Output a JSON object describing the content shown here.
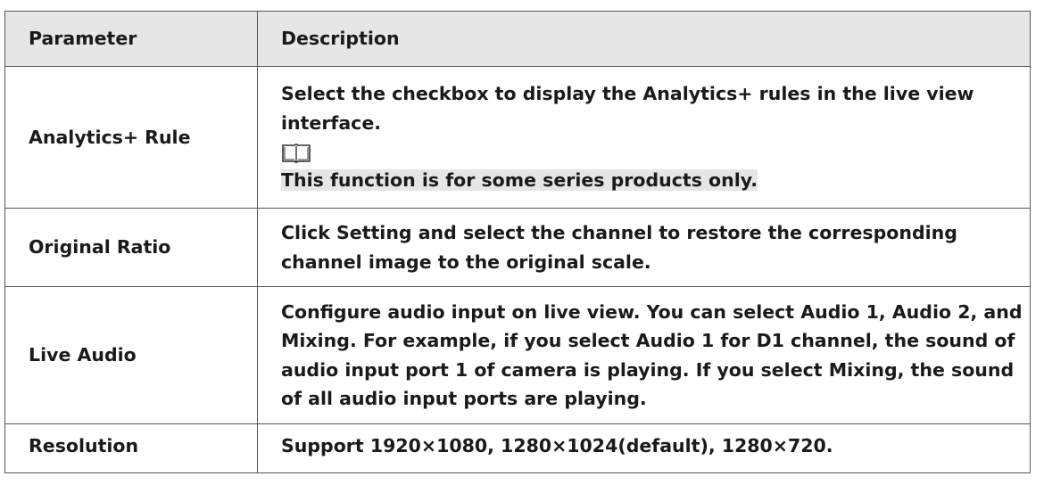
{
  "table": {
    "headers": {
      "parameter": "Parameter",
      "description": "Description"
    },
    "rows": [
      {
        "parameter": "Analytics+ Rule",
        "description": "Select the checkbox to display the Analytics+ rules in the live view interface.",
        "note_icon": "book-note-icon",
        "note": "This function is for some series products only."
      },
      {
        "parameter": "Original Ratio",
        "description": "Click Setting and select the channel to restore the corresponding channel image to the original scale."
      },
      {
        "parameter": "Live Audio",
        "description": "Configure audio input on live view. You can select Audio 1, Audio 2, and Mixing. For example, if you select Audio 1 for D1 channel, the sound of audio input port 1 of camera is playing. If you select Mixing, the sound of all audio input ports are playing."
      },
      {
        "parameter": "Resolution",
        "description": "Support 1920×1080, 1280×1024(default), 1280×720."
      }
    ]
  },
  "colors": {
    "header_bg": "#e6e6e6",
    "note_bg": "#e6e6e6",
    "border": "#555555",
    "text": "#1a1a1a"
  }
}
